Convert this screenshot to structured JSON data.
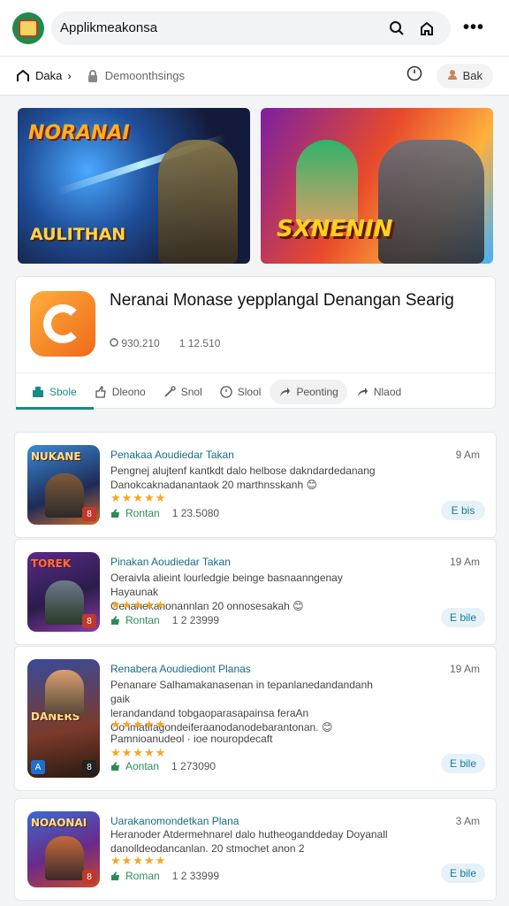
{
  "topbar": {
    "title": "Applikmeakonsa",
    "icons": [
      "search-icon",
      "home-icon",
      "more-icon"
    ]
  },
  "navbar": {
    "home_label": "Daka",
    "crumb_sep": "›",
    "lock_label": "Demoonthsings",
    "stat_label": "Bak"
  },
  "banners": [
    {
      "title_top": "NORANAI",
      "title_bottom": "AULITHAN"
    },
    {
      "title": "SXNENIN"
    }
  ],
  "app": {
    "title": "Neranai Monase yepplangal Denangan Searig",
    "meta": [
      "930.210",
      "1 12.510"
    ],
    "tabs": [
      {
        "label": "Sbole",
        "icon": "app-icon"
      },
      {
        "label": "Dleono",
        "icon": "like-icon"
      },
      {
        "label": "Snol",
        "icon": "tools-icon"
      },
      {
        "label": "Slool",
        "icon": "clock-icon"
      },
      {
        "label": "Peonting",
        "icon": "share-icon"
      },
      {
        "label": "Nlaod",
        "icon": "share-icon"
      }
    ]
  },
  "posts": [
    {
      "thumb": "NUKANE",
      "title": "Penakaa Aoudiedar Takan",
      "time": "9 Am",
      "desc": [
        "Pengnej alujtenf kantkdt dalo helbose dakndardedanang",
        "Danokcaknadanantaok 20 marthnsskanh 😊"
      ],
      "stars": "★★★★★",
      "status": "Rontan",
      "count": "1 23.5080",
      "button": "E bis"
    },
    {
      "thumb": "TOREK",
      "title": "Pinakan Aoudiedar Takan",
      "time": "19 Am",
      "desc": [
        "Oeraivla alieint lourledgie beinge basnaanngenay Hayaunak",
        "Genanekanonannlan 20 onnosesakah 😊"
      ],
      "stars": "★★★★★",
      "status": "Rontan",
      "count": "1 2 23999",
      "button": "E bile"
    },
    {
      "thumb": "DANERS",
      "title": "Renabera Aoudiediont Planas",
      "time": "19 Am",
      "desc": [
        "Penanare Salhamakanasenan in tepanlanedandandanh gaik",
        "lerandandand tobgaoparasapainsa feraAn",
        "Oo imatifagondeiferaanodanodebarantonan. 😊"
      ],
      "stars": "★★★★★",
      "extra": "Pamnioanudeol · ioe nouropdecaft",
      "stars2": "★★★★★",
      "status": "Aontan",
      "count": "1 273090",
      "button": "E bile"
    },
    {
      "thumb": "NOAONAI",
      "title": "Uarakanomondetkan Plana",
      "time": "3 Am",
      "desc": [
        "Heranoder Atdermehnarel dalo hutheoganddeday Doyanall",
        "danolldeodancanlan. 20 stmochet anon 2"
      ],
      "stars": "★★★★★",
      "status": "Roman",
      "count": "1 2 33999",
      "button": "E bile"
    }
  ],
  "colors": {
    "accent": "#1a8a86",
    "link": "#166b87",
    "star": "#f5a623",
    "status": "#2e8b57"
  }
}
